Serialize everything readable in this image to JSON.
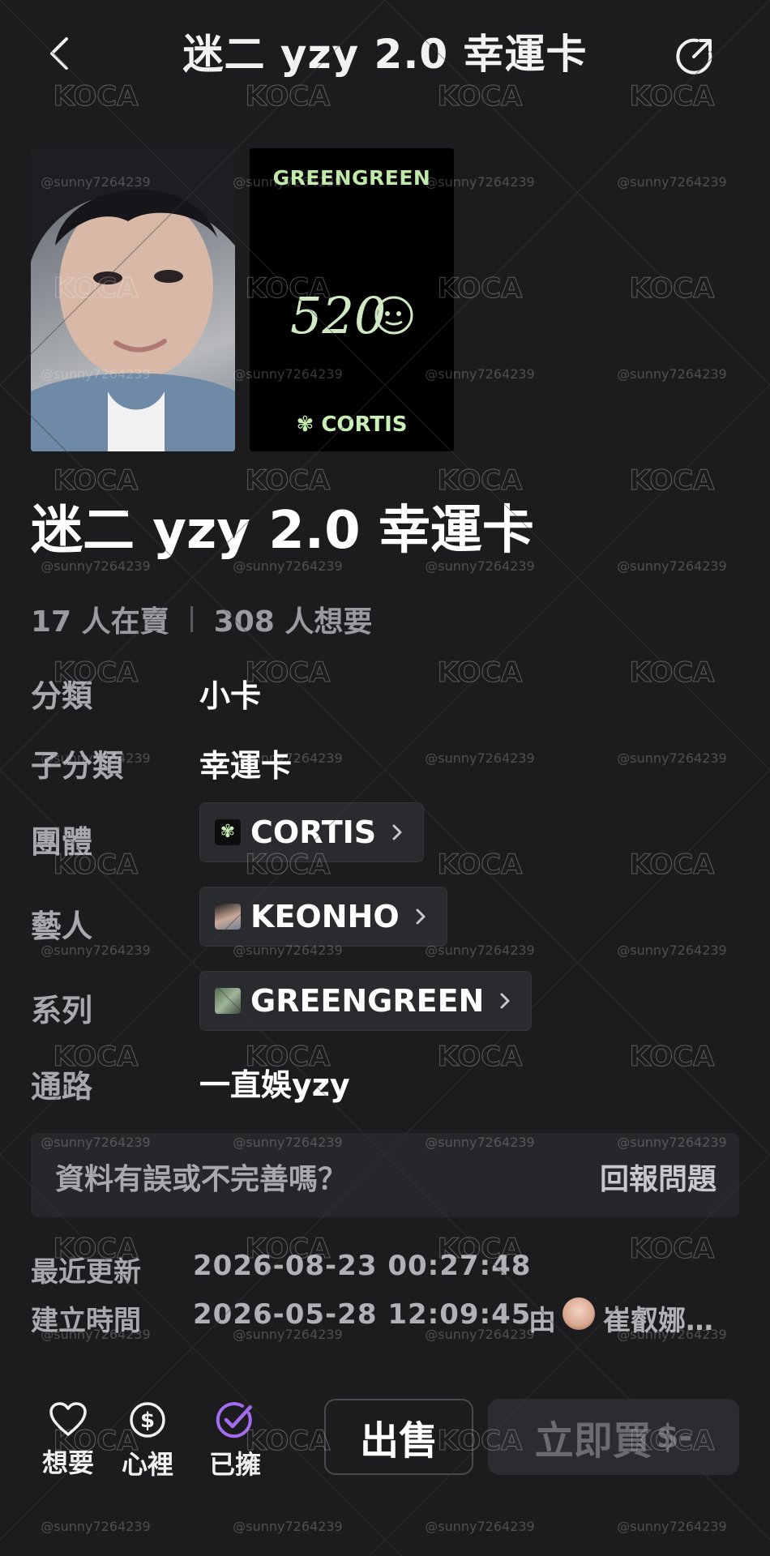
{
  "header": {
    "title": "迷二 yzy 2.0 幸運卡",
    "back_icon": "chevron-left-icon",
    "share_icon": "share-icon"
  },
  "images": {
    "front_alt": "card front photo",
    "back_top_text": "GREENGREEN",
    "back_handwriting": "520",
    "back_brand": "CORTIS"
  },
  "title": "迷二 yzy 2.0 幸運卡",
  "stats": {
    "selling": "17 人在賣",
    "wanting": "308 人想要"
  },
  "info": {
    "category_label": "分類",
    "category_value": "小卡",
    "subcategory_label": "子分類",
    "subcategory_value": "幸運卡",
    "group_label": "團體",
    "group_value": "CORTIS",
    "artist_label": "藝人",
    "artist_value": "KEONHO",
    "series_label": "系列",
    "series_value": "GREENGREEN",
    "channel_label": "通路",
    "channel_value": "一直娛yzy"
  },
  "report": {
    "question": "資料有誤或不完善嗎？",
    "link": "回報問題"
  },
  "meta": {
    "updated_label": "最近更新",
    "updated_value": "2026-08-23 00:27:48",
    "created_label": "建立時間",
    "created_value": "2026-05-28 12:09:45",
    "by_label": "由",
    "creator_name": "崔叡娜…"
  },
  "bottom": {
    "want_label": "想要",
    "want_icon": "heart-icon",
    "wishlist_label": "心裡",
    "wishlist_icon": "dollar-circle-icon",
    "owned_label": "已擁",
    "owned_icon": "check-circle-icon",
    "sell_label": "出售",
    "buy_label": "立即買",
    "buy_suffix": "$-"
  },
  "watermark": {
    "brand": "KOCA",
    "handle": "@sunny7264239"
  },
  "colors": {
    "background": "#1c1c1e",
    "accent_purple": "#a46cf0",
    "card_text_green": "#bfe8a8"
  }
}
